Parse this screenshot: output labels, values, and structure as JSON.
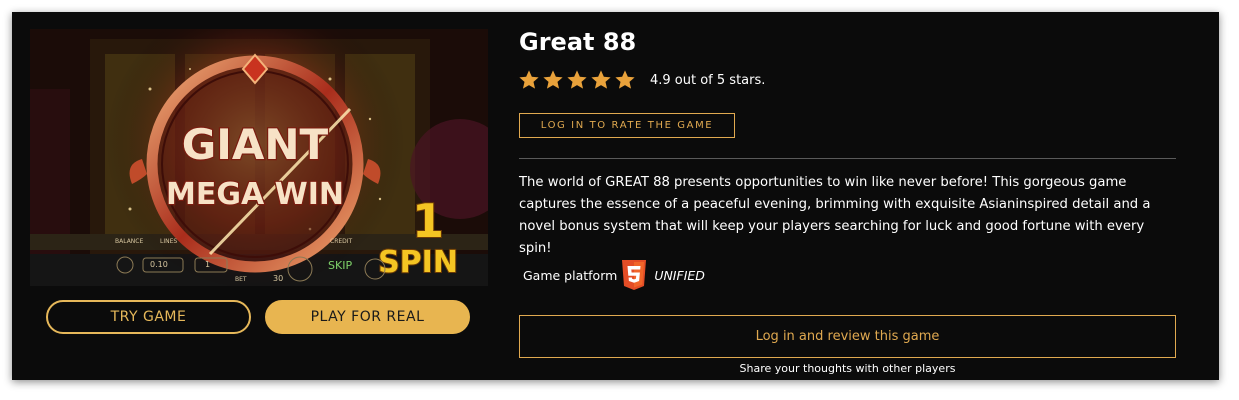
{
  "game": {
    "title": "Great 88",
    "rating": 4.9,
    "rating_max": 5,
    "rating_text": "4.9 out of 5 stars.",
    "description": "The world of GREAT 88 presents opportunities to win like never before! This gorgeous game captures the essence of a peaceful evening, brimming with exquisite Asianinspired detail and a novel bonus system that will keep your players searching for luck and good fortune with every spin!"
  },
  "artwork": {
    "line1": "GIANT",
    "line2": "MEGA WIN",
    "spin_count": "1",
    "spin_word": "SPIN",
    "reel_labels": [
      "BALANCE",
      "LINES",
      "CREDIT",
      "BET",
      "SKIP"
    ],
    "reel_values": [
      "0.10",
      "1",
      "30"
    ]
  },
  "buttons": {
    "try_label": "TRY GAME",
    "real_label": "PLAY FOR REAL",
    "rate_label": "LOG IN TO RATE THE GAME",
    "review_label": "Log in and review this game"
  },
  "platform": {
    "label": "Game platform",
    "icon": "html5-icon",
    "value": "UNIFIED"
  },
  "share_text": "Share your thoughts with other players",
  "colors": {
    "background": "#0b0b0b",
    "accent": "#e0a950",
    "button_fill": "#e8b550",
    "star": "#e9a23b",
    "html5": "#e44d26"
  }
}
